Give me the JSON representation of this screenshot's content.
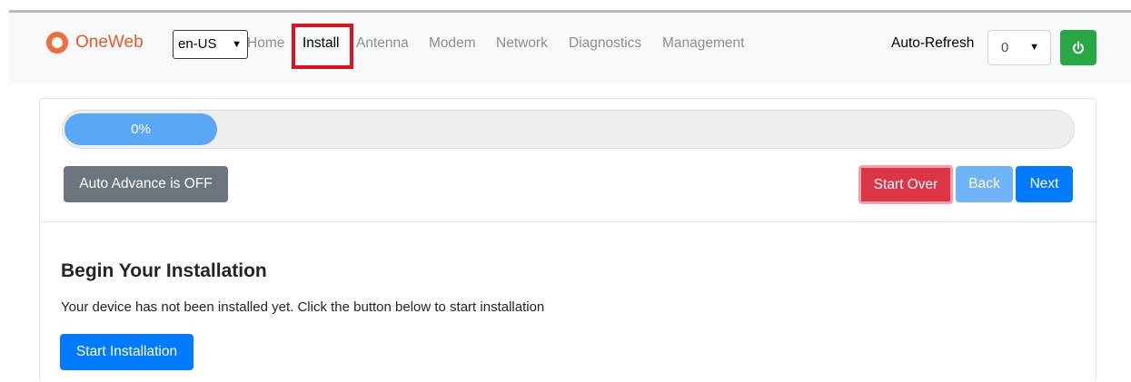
{
  "brand": {
    "name": "OneWeb",
    "color": "#e8592a"
  },
  "language": {
    "selected": "en-US"
  },
  "nav": {
    "items": [
      {
        "label": "Home",
        "active": false
      },
      {
        "label": "Install",
        "active": true
      },
      {
        "label": "Antenna",
        "active": false
      },
      {
        "label": "Modem",
        "active": false
      },
      {
        "label": "Network",
        "active": false
      },
      {
        "label": "Diagnostics",
        "active": false
      },
      {
        "label": "Management",
        "active": false
      }
    ]
  },
  "auto_refresh": {
    "label": "Auto-Refresh",
    "selected": "0"
  },
  "power": {
    "icon": "power-icon",
    "color": "#28a745"
  },
  "progress": {
    "label": "0%",
    "value": 0
  },
  "controls": {
    "auto_advance_label": "Auto Advance is OFF",
    "start_over_label": "Start Over",
    "back_label": "Back",
    "next_label": "Next"
  },
  "content": {
    "heading": "Begin Your Installation",
    "description": "Your device has not been installed yet. Click the button below to start installation",
    "start_button": "Start Installation"
  }
}
